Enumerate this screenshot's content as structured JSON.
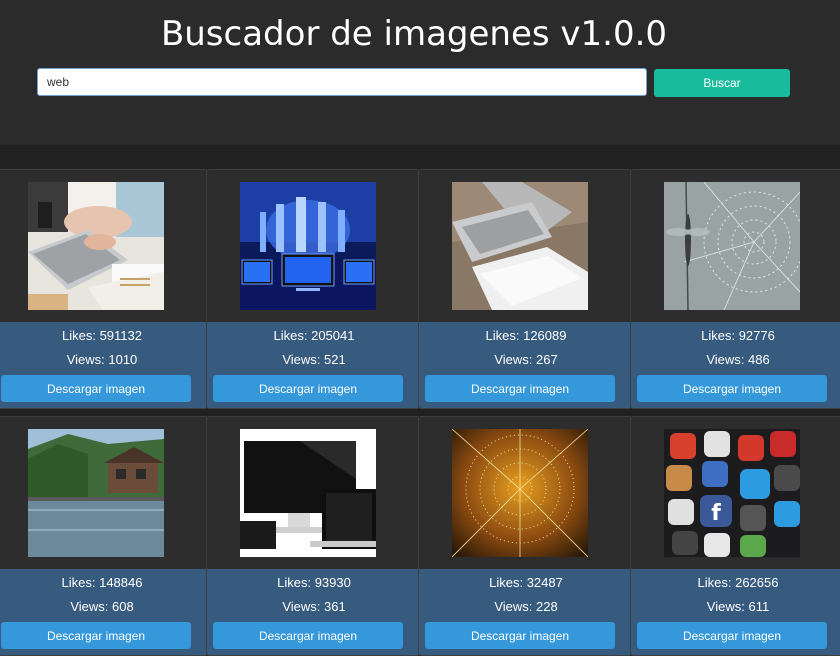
{
  "header": {
    "title": "Buscador de imagenes v1.0.0",
    "search_value": "web",
    "search_button": "Buscar"
  },
  "colors": {
    "page_background": "#212121",
    "header_background": "#2b2b2b",
    "search_button": "#18bc9c",
    "card_info": "#375a7f",
    "download_button": "#3498db"
  },
  "results": [
    {
      "likes": "Likes: 591132",
      "views": "Views: 1010",
      "download": "Descargar imagen",
      "image": "laptop-workspace-photo"
    },
    {
      "likes": "Likes: 205041",
      "views": "Views: 521",
      "download": "Descargar imagen",
      "image": "monitors-city-photo"
    },
    {
      "likes": "Likes: 126089",
      "views": "Views: 267",
      "download": "Descargar imagen",
      "image": "laptop-on-desk-photo"
    },
    {
      "likes": "Likes: 92776",
      "views": "Views: 486",
      "download": "Descargar imagen",
      "image": "dragonfly-web-photo"
    },
    {
      "likes": "Likes: 148846",
      "views": "Views: 608",
      "download": "Descargar imagen",
      "image": "lake-house-photo"
    },
    {
      "likes": "Likes: 93930",
      "views": "Views: 361",
      "download": "Descargar imagen",
      "image": "devices-mockup-photo"
    },
    {
      "likes": "Likes: 32487",
      "views": "Views: 228",
      "download": "Descargar imagen",
      "image": "dewy-spiderweb-photo"
    },
    {
      "likes": "Likes: 262656",
      "views": "Views: 611",
      "download": "Descargar imagen",
      "image": "social-apps-photo"
    }
  ]
}
